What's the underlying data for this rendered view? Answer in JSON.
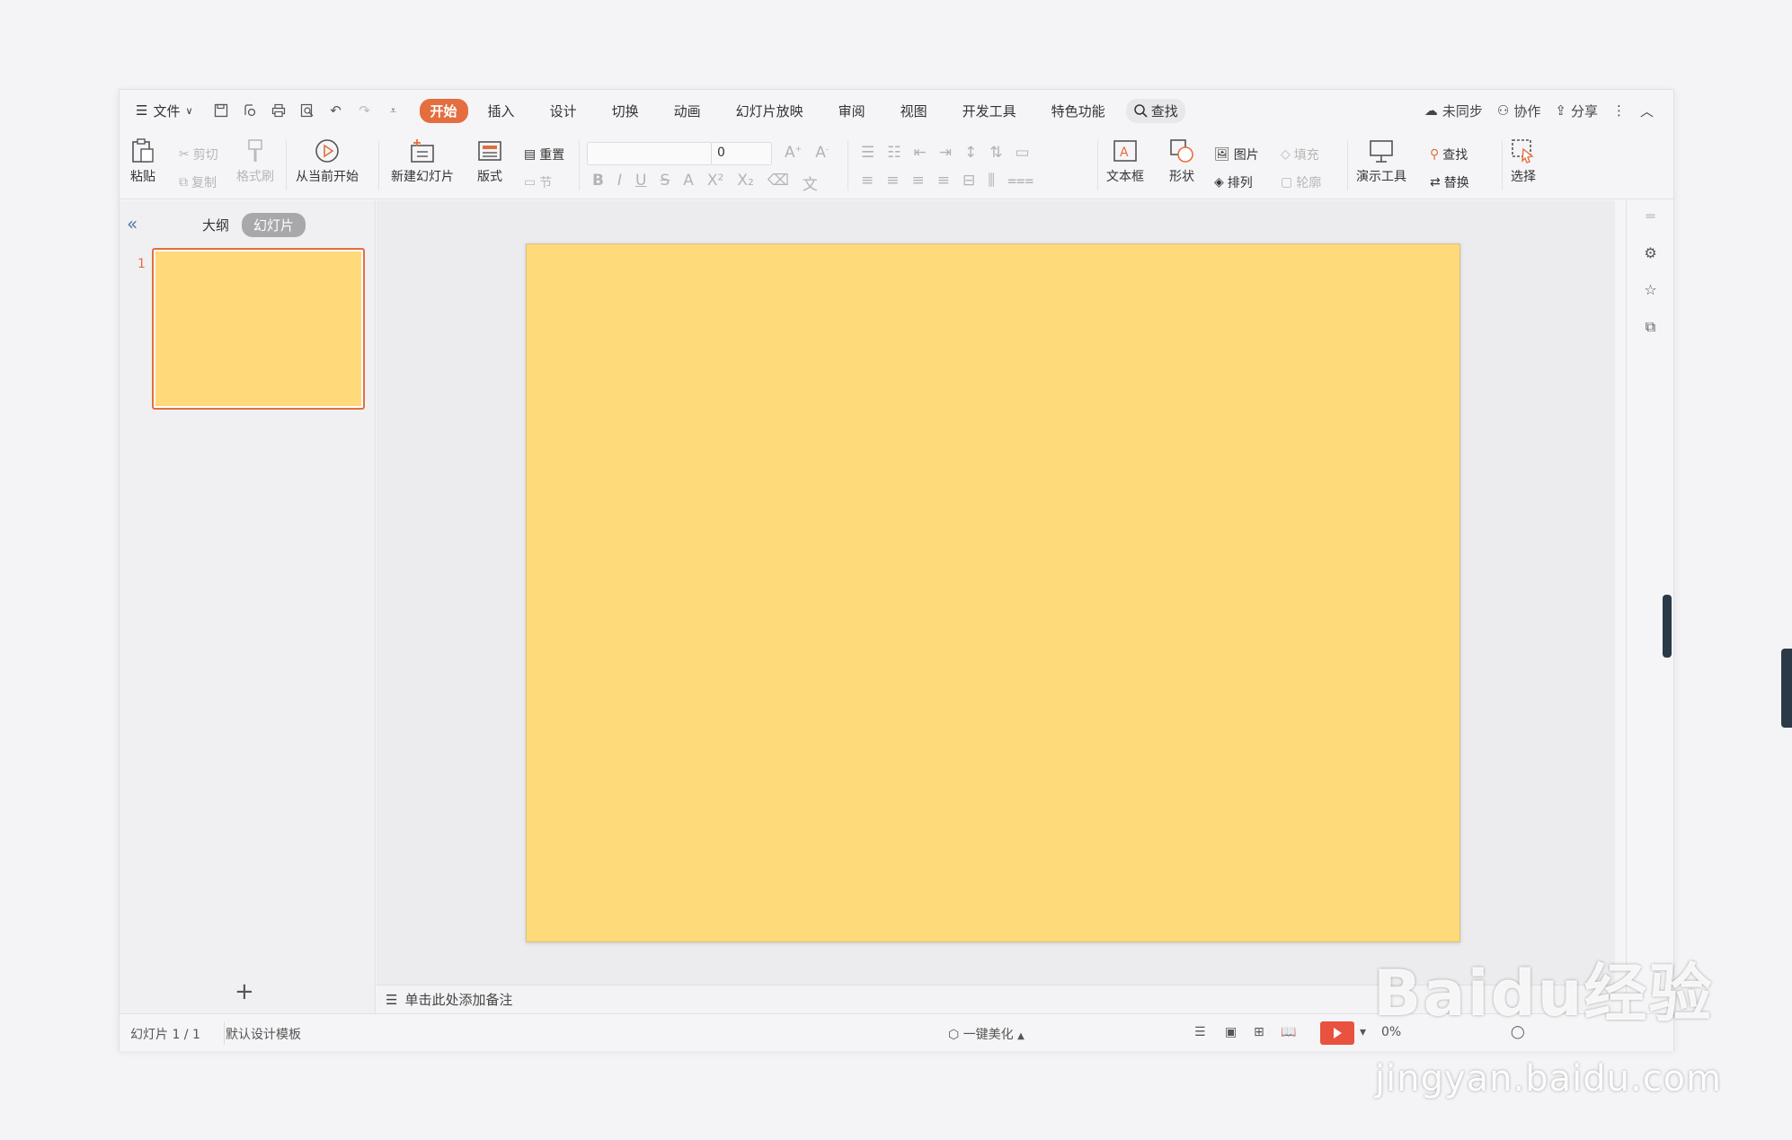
{
  "menubar": {
    "file": "文件",
    "tabs": [
      "开始",
      "插入",
      "设计",
      "切换",
      "动画",
      "幻灯片放映",
      "审阅",
      "视图",
      "开发工具",
      "特色功能"
    ],
    "search": "查找",
    "sync": "未同步",
    "collab": "协作",
    "share": "分享"
  },
  "ribbon": {
    "paste": "粘贴",
    "cut": "剪切",
    "copy": "复制",
    "format_painter": "格式刷",
    "play_from_current": "从当前开始",
    "new_slide": "新建幻灯片",
    "layout": "版式",
    "reset": "重置",
    "section": "节",
    "font_size": "0",
    "textbox": "文本框",
    "shape": "形状",
    "picture": "图片",
    "fill": "填充",
    "arrange": "排列",
    "outline": "轮廓",
    "presentation_tools": "演示工具",
    "find": "查找",
    "replace": "替换",
    "select": "选择"
  },
  "leftpanel": {
    "tab_outline": "大纲",
    "tab_slides": "幻灯片",
    "thumb_number": "1"
  },
  "notes": {
    "placeholder": "单击此处添加备注"
  },
  "status": {
    "slide_count": "幻灯片 1 / 1",
    "template": "默认设计模板",
    "beautify": "一键美化",
    "zoom": "0%"
  },
  "watermark": {
    "brand": "Baidu经验",
    "url": "jingyan.baidu.com"
  },
  "colors": {
    "accent": "#e46e3f",
    "slide_bg": "#ffda7a",
    "play": "#e8523f"
  }
}
